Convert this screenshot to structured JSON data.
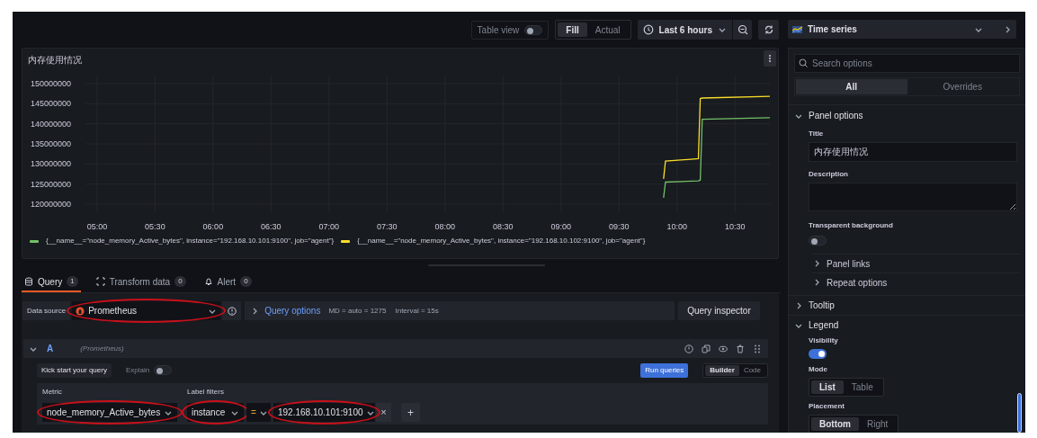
{
  "toolbar": {
    "table_view": {
      "label": "Table view",
      "on": false
    },
    "fit_modes": [
      {
        "label": "Fill",
        "selected": true
      },
      {
        "label": "Actual",
        "selected": false
      }
    ],
    "time_range": "Last 6 hours"
  },
  "panel": {
    "title": "内存使用情况",
    "chart_data": {
      "type": "line",
      "grid": true,
      "x": [
        593,
        594,
        611,
        612,
        613,
        648
      ],
      "xlim": [
        294,
        648
      ],
      "ylim": [
        118000000,
        152000000
      ],
      "xticks": [
        {
          "value": 300,
          "label": "05:00"
        },
        {
          "value": 330,
          "label": "05:30"
        },
        {
          "value": 360,
          "label": "06:00"
        },
        {
          "value": 390,
          "label": "06:30"
        },
        {
          "value": 420,
          "label": "07:00"
        },
        {
          "value": 450,
          "label": "07:30"
        },
        {
          "value": 480,
          "label": "08:00"
        },
        {
          "value": 510,
          "label": "08:30"
        },
        {
          "value": 540,
          "label": "09:00"
        },
        {
          "value": 570,
          "label": "09:30"
        },
        {
          "value": 600,
          "label": "10:00"
        },
        {
          "value": 630,
          "label": "10:30"
        }
      ],
      "yticks": [
        120000000,
        125000000,
        130000000,
        135000000,
        140000000,
        145000000,
        150000000
      ],
      "series": [
        {
          "name": "{__name__=\"node_memory_Active_bytes\", instance=\"192.168.10.101:9100\", job=\"agent\"}",
          "color": "#73bf69",
          "values": [
            121600000,
            125500000,
            125800000,
            126000000,
            141100000,
            141500000
          ]
        },
        {
          "name": "{__name__=\"node_memory_Active_bytes\", instance=\"192.168.10.102:9100\", job=\"agent\"}",
          "color": "#fade2a",
          "values": [
            126300000,
            130700000,
            131300000,
            146300000,
            146400000,
            146800000
          ]
        }
      ]
    }
  },
  "query_tabs": [
    {
      "label": "Query",
      "count": "1",
      "selected": true
    },
    {
      "label": "Transform data",
      "count": "0",
      "selected": false
    },
    {
      "label": "Alert",
      "count": "0",
      "selected": false
    }
  ],
  "data_source": {
    "label": "Data source",
    "value": "Prometheus",
    "highlighted": true
  },
  "query_options": {
    "label": "Query options",
    "md": "MD = auto = 1275",
    "interval": "Interval = 15s"
  },
  "query_inspector": "Query inspector",
  "query": {
    "ref": "A",
    "source": "(Prometheus)",
    "kick_start": "Kick start your query",
    "explain": {
      "label": "Explain",
      "on": false
    },
    "run": "Run queries",
    "modes": [
      {
        "label": "Builder",
        "selected": true
      },
      {
        "label": "Code",
        "selected": false
      }
    ],
    "metric": {
      "label": "Metric",
      "value": "node_memory_Active_bytes",
      "highlighted": true
    },
    "label_filters": {
      "label": "Label filters",
      "key": {
        "value": "instance",
        "highlighted": true
      },
      "operator": {
        "value": "="
      },
      "value": {
        "value": "192.168.10.101:9100",
        "highlighted": true
      },
      "remove": "×",
      "add": "+"
    }
  },
  "options_pane": {
    "visualization": "Time series",
    "search": {
      "placeholder": "Search options"
    },
    "tabs": [
      {
        "label": "All",
        "selected": true
      },
      {
        "label": "Overrides",
        "selected": false
      }
    ],
    "panel_options": {
      "label": "Panel options",
      "expanded": true,
      "title_label": "Title",
      "title_value": "内存使用情况",
      "description_label": "Description",
      "transparent": {
        "label": "Transparent background",
        "on": false
      },
      "subsections": [
        {
          "label": "Panel links",
          "expanded": false
        },
        {
          "label": "Repeat options",
          "expanded": false
        }
      ]
    },
    "tooltip": {
      "label": "Tooltip",
      "expanded": false
    },
    "legend": {
      "label": "Legend",
      "expanded": true,
      "visibility": {
        "label": "Visibility",
        "on": true
      },
      "mode": {
        "label": "Mode",
        "options": [
          {
            "label": "List",
            "selected": true
          },
          {
            "label": "Table",
            "selected": false
          }
        ]
      },
      "placement": {
        "label": "Placement",
        "options": [
          {
            "label": "Bottom",
            "selected": true
          },
          {
            "label": "Right",
            "selected": false
          }
        ]
      }
    }
  }
}
